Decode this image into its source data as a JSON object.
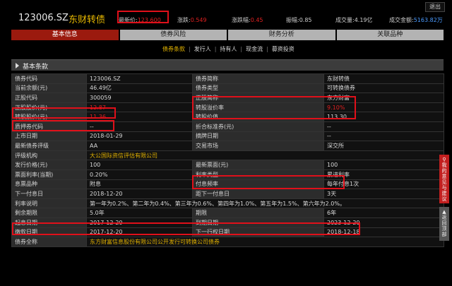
{
  "header": {
    "code": "123006.SZ",
    "name": "东财转债",
    "latest_price_label": "最新价:",
    "latest_price": "123.600",
    "change_label": "涨跌:",
    "change": "0.549",
    "change_pct_label": "涨跌幅:",
    "change_pct": "0.45",
    "amplitude_label": "振幅:",
    "amplitude": "0.85",
    "volume_label": "成交量:",
    "volume": "4.19亿",
    "turnover_label": "成交金额:",
    "turnover": "5163.82万",
    "quit_label": "退出"
  },
  "tabs": [
    "基本信息",
    "债券风险",
    "财务分析",
    "关联品种"
  ],
  "subnav": [
    "债券条款",
    "发行人",
    "持有人",
    "现金流",
    "募资投资"
  ],
  "section_title": "基本条款",
  "rows": [
    [
      "债券代码",
      "123006.SZ",
      "债券简称",
      "东财转债"
    ],
    [
      "当前余额(元)",
      "46.49亿",
      "债券类型",
      "可转换债券"
    ],
    [
      "正股代码",
      "300059",
      "正股简称",
      "东方财富"
    ],
    [
      "正股股价(元)",
      "12.87",
      "转股溢价率",
      "9.10%"
    ],
    [
      "转股股价(元)",
      "11.36",
      "转股价值",
      "113.30"
    ],
    [
      "质押券代码",
      "--",
      "折合标准券(元)",
      "--"
    ],
    [
      "上市日期",
      "2018-01-29",
      "摘牌日期",
      "--"
    ],
    [
      "最新债券评级",
      "AA",
      "交易市场",
      "深交所"
    ],
    [
      "评级机构",
      "大公国际资信评估有限公司"
    ],
    [
      "发行价格(元)",
      "100",
      "最新票面(元)",
      "100"
    ],
    [
      "票面利率(当期)",
      "0.20%",
      "利率类型",
      "累进利率"
    ],
    [
      "息票品种",
      "附息",
      "付息频率",
      "每年付息1次"
    ],
    [
      "下一付息日",
      "2018-12-20",
      "距下一付息日",
      "3天"
    ],
    [
      "利率说明",
      "第一年为0.2%、第二年为0.4%、第三年为0.6%、第四年为1.0%、第五年为1.5%、第六年为2.0%。"
    ],
    [
      "剩余期限",
      "5.0年",
      "期限",
      "6年"
    ],
    [
      "起息日期",
      "2017-12-20",
      "到期日期",
      "2023-12-20"
    ],
    [
      "缴款日期",
      "2017-12-20",
      "下一行权日期",
      "2018-12-18"
    ],
    [
      "债券全称",
      "东方财富信息股份有限公司公开发行可转换公司债券"
    ]
  ],
  "side": {
    "feedback_label": "我的意见与建议",
    "top_label": "返回顶部"
  },
  "colors": {
    "accent_red": "#9b1a0e",
    "highlight_box": "#e0101a",
    "price_red": "#e02020",
    "gold": "#e0b000"
  }
}
